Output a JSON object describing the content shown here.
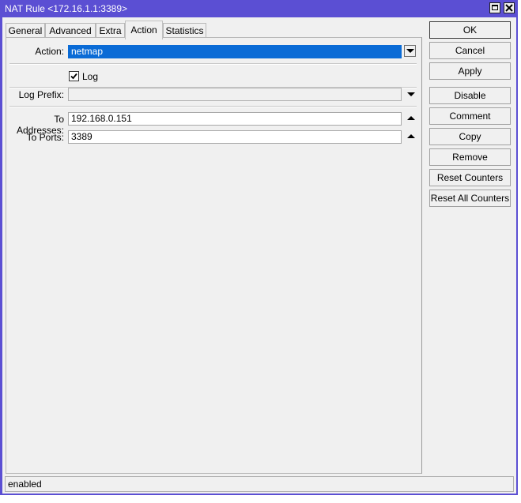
{
  "window": {
    "title": "NAT Rule <172.16.1.1:3389>"
  },
  "tabs": [
    {
      "label": "General"
    },
    {
      "label": "Advanced"
    },
    {
      "label": "Extra"
    },
    {
      "label": "Action"
    },
    {
      "label": "Statistics"
    }
  ],
  "active_tab": "Action",
  "form": {
    "action": {
      "label": "Action:",
      "value": "netmap"
    },
    "log": {
      "label": "Log",
      "checked": true
    },
    "log_prefix": {
      "label": "Log Prefix:",
      "value": ""
    },
    "to_addresses": {
      "label": "To Addresses:",
      "value": "192.168.0.151"
    },
    "to_ports": {
      "label": "To Ports:",
      "value": "3389"
    }
  },
  "buttons": {
    "ok": "OK",
    "cancel": "Cancel",
    "apply": "Apply",
    "disable": "Disable",
    "comment": "Comment",
    "copy": "Copy",
    "remove": "Remove",
    "reset_counters": "Reset Counters",
    "reset_all_counters": "Reset All Counters"
  },
  "status": {
    "text": "enabled"
  },
  "colors": {
    "titlebar": "#5b4fd3",
    "selection": "#0a6bd6",
    "window_bg": "#f0f0f0"
  }
}
